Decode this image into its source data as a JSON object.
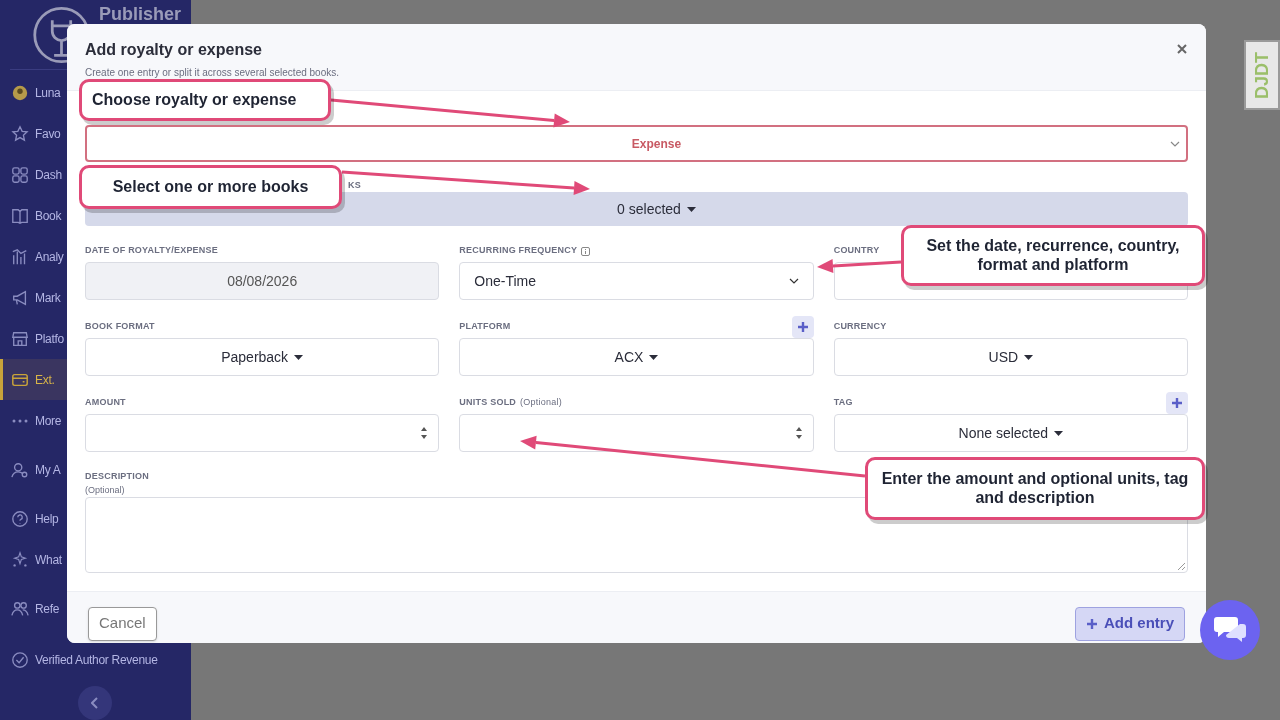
{
  "sidebar": {
    "brand": "Publisher",
    "items": [
      {
        "label": "Luna",
        "selected": false
      },
      {
        "label": "Favo",
        "selected": false
      },
      {
        "label": "Dash",
        "selected": false
      },
      {
        "label": "Book",
        "selected": false
      },
      {
        "label": "Analy",
        "selected": false
      },
      {
        "label": "Mark",
        "selected": false
      },
      {
        "label": "Platfo",
        "selected": false
      },
      {
        "label": "Ext.",
        "selected": true
      },
      {
        "label": "More",
        "selected": false
      },
      {
        "label": "My A",
        "selected": false
      },
      {
        "label": "Help",
        "selected": false
      },
      {
        "label": "What",
        "selected": false
      },
      {
        "label": "Refe",
        "selected": false
      },
      {
        "label": "Verified Author Revenue",
        "selected": false
      }
    ]
  },
  "debug_tab": "DJDT",
  "modal": {
    "title": "Add royalty or expense",
    "subtitle": "Create one entry or split it across several selected books.",
    "type_select": {
      "value": "Expense"
    },
    "books": {
      "label": "KS",
      "value": "0 selected"
    },
    "fields": [
      {
        "kind": "date",
        "label": "DATE OF ROYALTY/EXPENSE",
        "value": "08/08/2026",
        "disabled": true
      },
      {
        "kind": "select",
        "label": "RECURRING FREQUENCY",
        "info": true,
        "value": "One-Time"
      },
      {
        "kind": "text",
        "label": "COUNTRY"
      },
      {
        "kind": "dropdown",
        "label": "BOOK FORMAT",
        "value": "Paperback"
      },
      {
        "kind": "dropdown",
        "label": "PLATFORM",
        "add": true,
        "value": "ACX"
      },
      {
        "kind": "dropdown",
        "label": "CURRENCY",
        "value": "USD"
      },
      {
        "kind": "number",
        "label": "AMOUNT"
      },
      {
        "kind": "number",
        "label": "UNITS SOLD",
        "optional": "(Optional)"
      },
      {
        "kind": "dropdown",
        "label": "TAG",
        "add": true,
        "value": "None selected"
      }
    ],
    "description": {
      "label": "DESCRIPTION",
      "optional": "(Optional)"
    },
    "cancel": "Cancel",
    "submit": "Add entry"
  },
  "callouts": [
    "Choose royalty or expense",
    "Select one or more books",
    "Set the date, recurrence, country, format and platform",
    "Enter the amount and optional units, tag and description"
  ]
}
